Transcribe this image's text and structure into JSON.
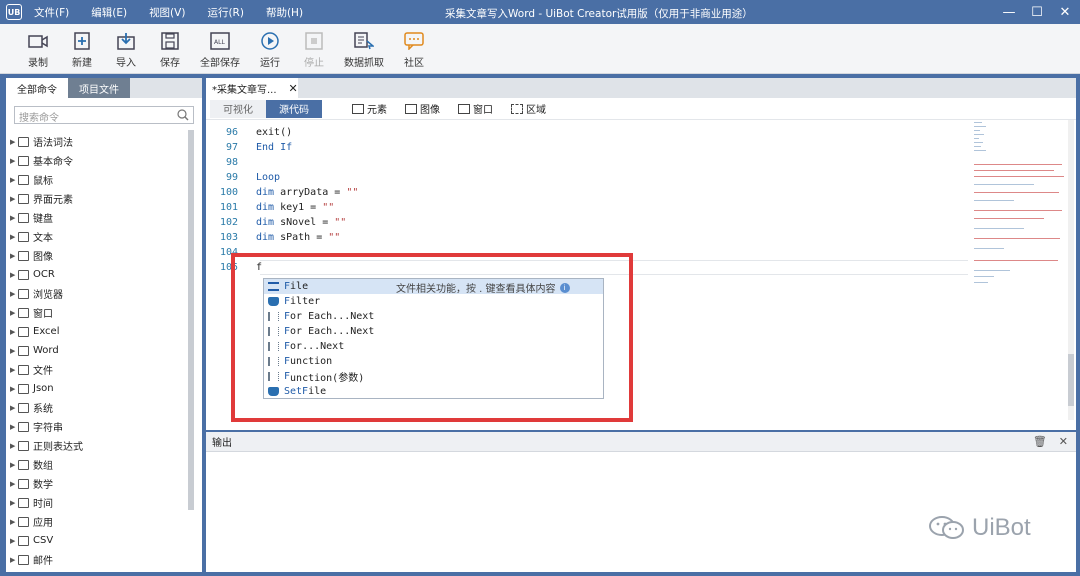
{
  "titlebar": {
    "logo": "UB",
    "menus": [
      "文件(F)",
      "编辑(E)",
      "视图(V)",
      "运行(R)",
      "帮助(H)"
    ],
    "window_title": "采集文章写入Word - UiBot Creator试用版（仅用于非商业用途）"
  },
  "toolbar": {
    "record": "录制",
    "new": "新建",
    "import": "导入",
    "save": "保存",
    "save_all": "全部保存",
    "run": "运行",
    "stop": "停止",
    "data_capture": "数据抓取",
    "community": "社区"
  },
  "left": {
    "tabs": [
      "全部命令",
      "项目文件"
    ],
    "search_placeholder": "搜索命令",
    "tree": [
      "语法词法",
      "基本命令",
      "鼠标",
      "界面元素",
      "键盘",
      "文本",
      "图像",
      "OCR",
      "浏览器",
      "窗口",
      "Excel",
      "Word",
      "文件",
      "Json",
      "系统",
      "字符串",
      "正则表达式",
      "数组",
      "数学",
      "时间",
      "应用",
      "CSV",
      "邮件"
    ]
  },
  "editor": {
    "doc_tab": "*采集文章写...",
    "views": {
      "visual": "可视化",
      "source": "源代码"
    },
    "insert": {
      "element": "元素",
      "image": "图像",
      "window": "窗口",
      "region": "区域"
    },
    "lines": [
      {
        "n": "96",
        "k": "",
        "t": "exit()"
      },
      {
        "n": "97",
        "k": "End If",
        "t": ""
      },
      {
        "n": "98",
        "k": "",
        "t": ""
      },
      {
        "n": "99",
        "k": "Loop",
        "t": ""
      },
      {
        "n": "100",
        "k": "dim",
        "t": " arryData = ",
        "s": "\"\""
      },
      {
        "n": "101",
        "k": "dim",
        "t": " key1 = ",
        "s": "\"\""
      },
      {
        "n": "102",
        "k": "dim",
        "t": " sNovel = ",
        "s": "\"\""
      },
      {
        "n": "103",
        "k": "dim",
        "t": " sPath = ",
        "s": "\"\""
      },
      {
        "n": "104",
        "k": "",
        "t": ""
      },
      {
        "n": "105",
        "k": "",
        "t": "f"
      }
    ]
  },
  "autocomplete": {
    "hint": "文件相关功能，按 . 键查看具体内容",
    "items": [
      {
        "h": "F",
        "r": "ile",
        "icon": "function-icon"
      },
      {
        "h": "F",
        "r": "ilter",
        "icon": "cube-icon"
      },
      {
        "h": "F",
        "r": "or Each...Next",
        "icon": "snippet-icon"
      },
      {
        "h": "F",
        "r": "or Each...Next",
        "icon": "snippet-icon"
      },
      {
        "h": "F",
        "r": "or...Next",
        "icon": "snippet-icon"
      },
      {
        "h": "F",
        "r": "unction",
        "icon": "snippet-icon"
      },
      {
        "h": "F",
        "r": "unction(参数)",
        "icon": "snippet-icon"
      },
      {
        "h": "SetF",
        "r": "ile",
        "icon": "cube-icon"
      }
    ]
  },
  "output": {
    "title": "输出"
  },
  "watermark": "UiBot"
}
